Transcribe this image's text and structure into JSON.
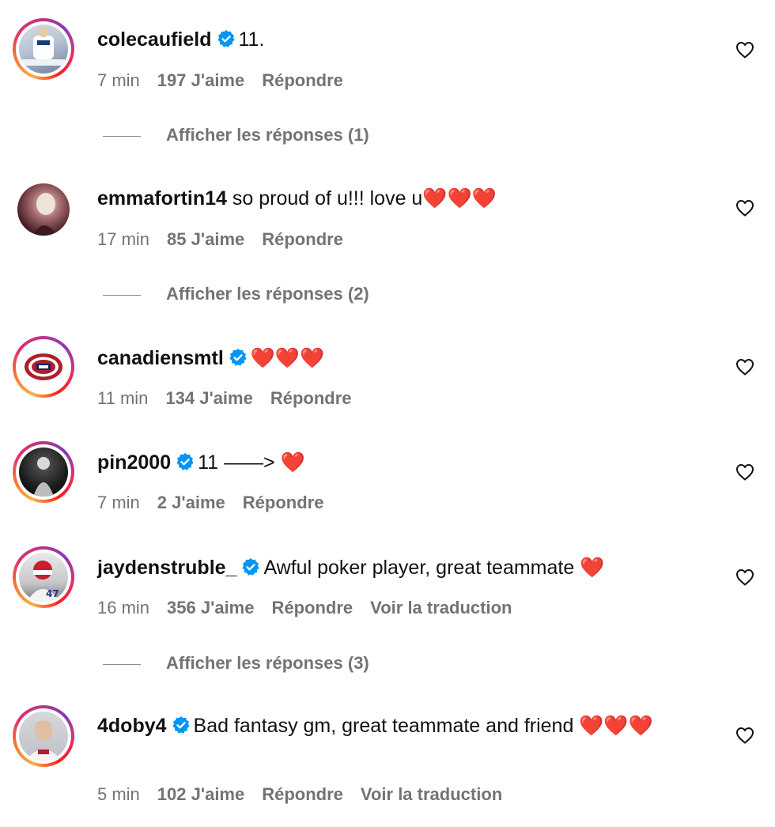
{
  "comments": [
    {
      "username": "colecaufield",
      "verified": true,
      "text": "11.",
      "time": "7 min",
      "likes": "197 J'aime",
      "reply": "Répondre",
      "translate": "",
      "replies_label": "Afficher les réponses (1)",
      "story_ring": true
    },
    {
      "username": "emmafortin14",
      "verified": false,
      "text": "so proud of u!!! love u❤️❤️❤️",
      "time": "17 min",
      "likes": "85 J'aime",
      "reply": "Répondre",
      "translate": "",
      "replies_label": "Afficher les réponses (2)",
      "story_ring": false
    },
    {
      "username": "canadiensmtl",
      "verified": true,
      "text": "❤️❤️❤️",
      "time": "11 min",
      "likes": "134 J'aime",
      "reply": "Répondre",
      "translate": "",
      "replies_label": "",
      "story_ring": true
    },
    {
      "username": "pin2000",
      "verified": true,
      "text": "11 ——> ❤️",
      "time": "7 min",
      "likes": "2 J'aime",
      "reply": "Répondre",
      "translate": "",
      "replies_label": "",
      "story_ring": true
    },
    {
      "username": "jaydenstruble_",
      "verified": true,
      "text": "Awful poker player, great teammate ❤️",
      "time": "16 min",
      "likes": "356 J'aime",
      "reply": "Répondre",
      "translate": "Voir la traduction",
      "replies_label": "Afficher les réponses (3)",
      "story_ring": true
    },
    {
      "username": "4doby4",
      "verified": true,
      "text": "Bad fantasy gm, great teammate and friend ❤️❤️❤️",
      "time": "5 min",
      "likes": "102 J'aime",
      "reply": "Répondre",
      "translate": "Voir la traduction",
      "replies_label": "",
      "story_ring": true
    }
  ],
  "icons": {
    "like": "heart-outline-icon",
    "verified": "verified-badge-icon"
  },
  "colors": {
    "meta": "#737373",
    "verified": "#0095f6",
    "heart_emoji": "#e0141e"
  }
}
